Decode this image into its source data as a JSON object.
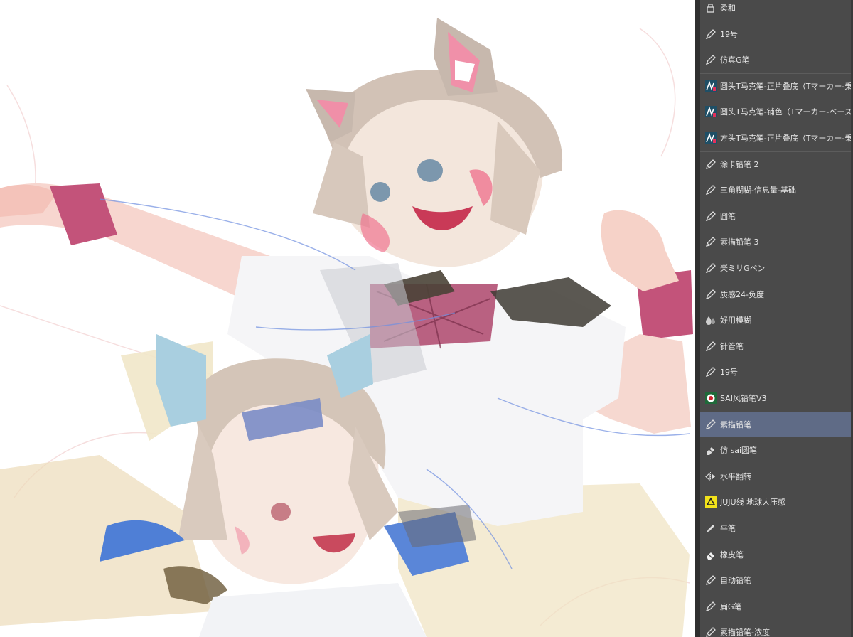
{
  "brush_panel": {
    "items": [
      {
        "label": "柔和",
        "icon": "airbrush-icon"
      },
      {
        "label": "19号",
        "icon": "pen-icon"
      },
      {
        "label": "仿真G笔",
        "icon": "pen-icon"
      },
      {
        "label": "圆头T马克笔-正片叠底（Tマーカー-乗",
        "icon": "marker-thumb-icon"
      },
      {
        "label": "圆头T马克笔-铺色（Tマーカー-ベース",
        "icon": "marker-thumb-icon"
      },
      {
        "label": "方头T马克笔-正片叠底（Tマーカー-乗",
        "icon": "marker-thumb-icon"
      },
      {
        "label": "涂卡铅笔 2",
        "icon": "pencil-icon"
      },
      {
        "label": "三角糊糊-信息量-基础",
        "icon": "pen-icon"
      },
      {
        "label": "圆笔",
        "icon": "pen-icon"
      },
      {
        "label": "素描铅笔 3",
        "icon": "pencil-icon"
      },
      {
        "label": "楽ミリGペン",
        "icon": "pen-icon"
      },
      {
        "label": "质感24-负度",
        "icon": "pen-icon"
      },
      {
        "label": "好用模糊",
        "icon": "blur-icon"
      },
      {
        "label": "针管笔",
        "icon": "pen-icon"
      },
      {
        "label": "19号",
        "icon": "pen-icon"
      },
      {
        "label": "SAI风铅笔V3",
        "icon": "sai-thumb-icon"
      },
      {
        "label": "素描铅笔",
        "icon": "pencil-icon",
        "selected": true
      },
      {
        "label": "仿 sai圆笔",
        "icon": "eraser-pen-icon"
      },
      {
        "label": "水平翻转",
        "icon": "flip-horizontal-icon"
      },
      {
        "label": "JUJU线 地球人压感",
        "icon": "juju-thumb-icon"
      },
      {
        "label": "平笔",
        "icon": "flat-brush-icon"
      },
      {
        "label": "橡皮笔",
        "icon": "eraser-icon"
      },
      {
        "label": "自动铅笔",
        "icon": "pencil-icon"
      },
      {
        "label": "扁G笔",
        "icon": "pen-icon"
      },
      {
        "label": "素描铅笔-浓度",
        "icon": "pencil-icon"
      }
    ]
  },
  "colors": {
    "panel_bg": "#4a4a4a",
    "selected_bg": "#5f6b86",
    "text": "#e6e6e6"
  }
}
